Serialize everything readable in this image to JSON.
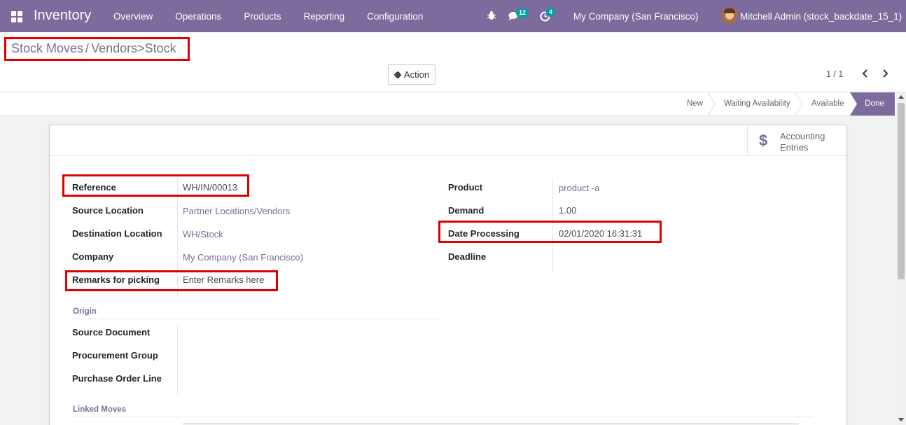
{
  "navbar": {
    "app_name": "Inventory",
    "menu": [
      "Overview",
      "Operations",
      "Products",
      "Reporting",
      "Configuration"
    ],
    "chat_count": "12",
    "activity_count": "4",
    "company": "My Company (San Francisco)",
    "user": "Mitchell Admin (stock_backdate_15_1)",
    "color": "#7c6b9c"
  },
  "breadcrumb": {
    "parent": "Stock Moves",
    "separator": "/",
    "current": "Vendors>Stock"
  },
  "toolbar": {
    "action_label": "Action",
    "pager": "1 / 1"
  },
  "status_stages": [
    "New",
    "Waiting Availability",
    "Available",
    "Done"
  ],
  "status_active": "Done",
  "smart_button": {
    "label": "Accounting Entries",
    "icon": "$"
  },
  "left_fields": [
    {
      "label": "Reference",
      "value": "WH/IN/00013"
    },
    {
      "label": "Source Location",
      "value": "Partner Locations/Vendors"
    },
    {
      "label": "Destination Location",
      "value": "WH/Stock"
    },
    {
      "label": "Company",
      "value": "My Company (San Francisco)"
    },
    {
      "label": "Remarks for picking",
      "value": "Enter Remarks here"
    }
  ],
  "right_fields": [
    {
      "label": "Product",
      "value": "product -a"
    },
    {
      "label": "Demand",
      "value": "1.00"
    },
    {
      "label": "Date Processing",
      "value": "02/01/2020 16:31:31"
    },
    {
      "label": "Deadline",
      "value": ""
    }
  ],
  "origin": {
    "title": "Origin",
    "fields": [
      {
        "label": "Source Document",
        "value": ""
      },
      {
        "label": "Procurement Group",
        "value": ""
      },
      {
        "label": "Purchase Order Line",
        "value": ""
      }
    ]
  },
  "linked_moves": {
    "title": "Linked Moves"
  },
  "highlight_color": "#e00000"
}
